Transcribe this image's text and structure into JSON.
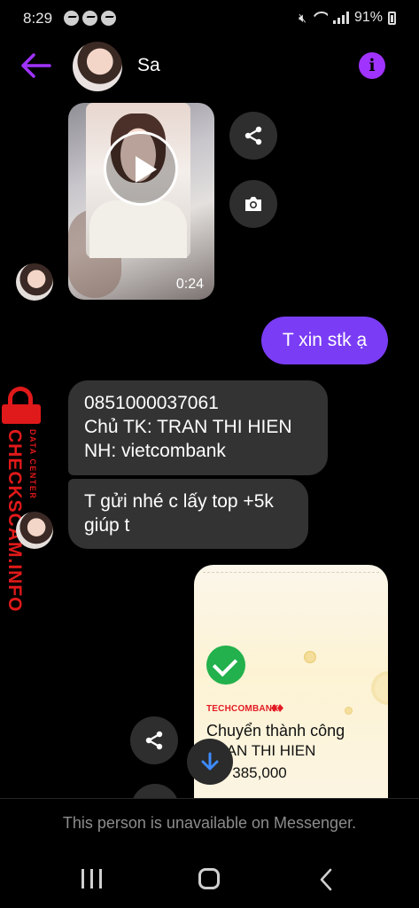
{
  "status_bar": {
    "time": "8:29",
    "battery": "91%"
  },
  "header": {
    "contact_name": "Sa"
  },
  "messages": {
    "video": {
      "duration": "0:24"
    },
    "outgoing_1": "T xin stk ạ",
    "incoming_1": [
      "0851000037061",
      "Chủ TK: TRAN THI HIEN",
      "NH: vietcombank"
    ],
    "incoming_2": [
      "T gửi nhé c lấy top +5k",
      "giúp t"
    ],
    "receipt": {
      "bank": "TECHCOMBANK",
      "title": "Chuyển thành công",
      "name_partial": "TRAN THI HIEN",
      "amount_partial": "ND 385,000"
    }
  },
  "watermark": {
    "main": "CHECKSCAM.INFO",
    "sub": "DATA CENTER"
  },
  "footer": {
    "notice": "This person is unavailable on Messenger."
  },
  "colors": {
    "accent": "#a033ff",
    "outgoing_bubble": "#7a3cf5",
    "incoming_bubble": "#333333",
    "watermark": "#e0191a"
  }
}
